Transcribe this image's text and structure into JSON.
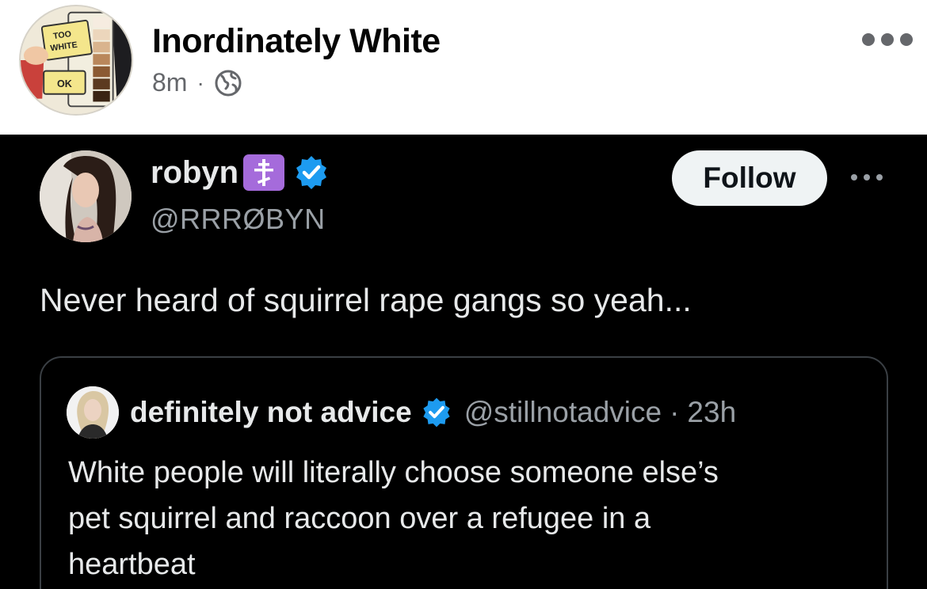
{
  "post": {
    "author_name": "Inordinately White",
    "time": "8m",
    "separator": "·",
    "visibility_icon": "globe-icon",
    "more_icon": "more-horizontal-icon",
    "avatar": {
      "label_top_line1": "TOO",
      "label_top_line2": "WHITE",
      "label_bottom": "OK"
    }
  },
  "tweet": {
    "display_name": "robyn",
    "badge_icon": "orthodox-cross-icon",
    "verified_icon": "verified-badge-icon",
    "handle": "@RRRØBYN",
    "follow_label": "Follow",
    "more_icon": "more-horizontal-icon",
    "text": "Never heard of squirrel rape gangs so yeah...",
    "colors": {
      "background": "#000000",
      "verified": "#1d9bf0",
      "badge": "#a56bdb"
    }
  },
  "quote": {
    "display_name": "definitely not advice",
    "handle": "@stillnotadvice",
    "separator": "·",
    "time": "23h",
    "text_lines": [
      "White people will literally choose someone else’s",
      "pet squirrel and raccoon over a refugee in a",
      "heartbeat"
    ]
  }
}
